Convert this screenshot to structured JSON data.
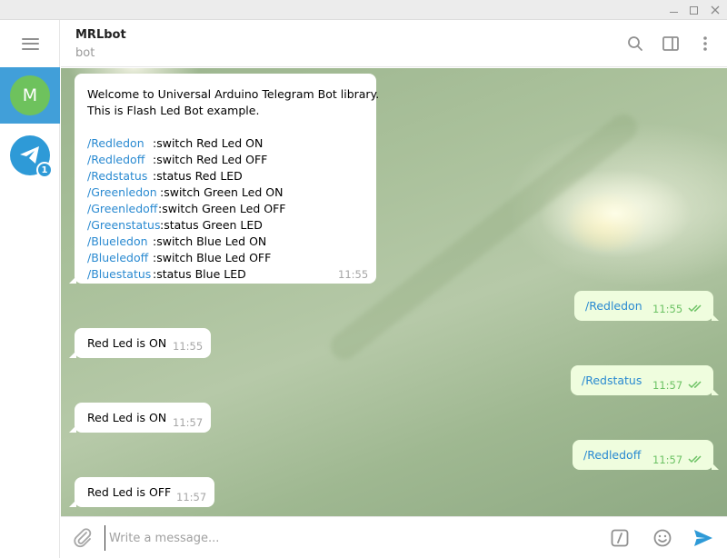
{
  "window": {
    "min_label": "",
    "max_label": ""
  },
  "sidebar": {
    "chats": [
      {
        "initial": "M",
        "active": true
      },
      {
        "initial": "",
        "unread": "1"
      }
    ]
  },
  "header": {
    "title": "MRLbot",
    "status": "bot"
  },
  "messages": {
    "welcome": {
      "line1": "Welcome to Universal Arduino Telegram Bot library.",
      "line2": "This is Flash Led Bot example.",
      "commands": [
        {
          "cmd": "/Redledon",
          "desc": ":switch Red Led ON"
        },
        {
          "cmd": "/Redledoff",
          "desc": ":switch Red Led OFF"
        },
        {
          "cmd": "/Redstatus",
          "desc": ":status Red LED"
        },
        {
          "cmd": "/Greenledon",
          "desc": ":switch Green Led ON"
        },
        {
          "cmd": "/Greenledoff",
          "desc": ":switch Green Led OFF"
        },
        {
          "cmd": "/Greenstatus",
          "desc": ":status Green LED"
        },
        {
          "cmd": "/Blueledon",
          "desc": ":switch Blue Led ON"
        },
        {
          "cmd": "/Blueledoff",
          "desc": ":switch Blue Led OFF"
        },
        {
          "cmd": "/Bluestatus",
          "desc": ":status Blue LED"
        }
      ],
      "time": "11:55"
    },
    "out1": {
      "text": "/Redledon",
      "time": "11:55"
    },
    "in1": {
      "text": "Red Led is ON",
      "time": "11:55"
    },
    "out2": {
      "text": "/Redstatus",
      "time": "11:57"
    },
    "in2": {
      "text": "Red Led is ON",
      "time": "11:57"
    },
    "out3": {
      "text": "/Redledoff",
      "time": "11:57"
    },
    "in3": {
      "text": "Red Led is OFF",
      "time": "11:57"
    }
  },
  "composer": {
    "placeholder": "Write a message..."
  },
  "colors": {
    "accent": "#419fd9",
    "avatar_m": "#6ec25d",
    "outgoing_bubble": "#effdde",
    "link": "#2a8ad1"
  }
}
